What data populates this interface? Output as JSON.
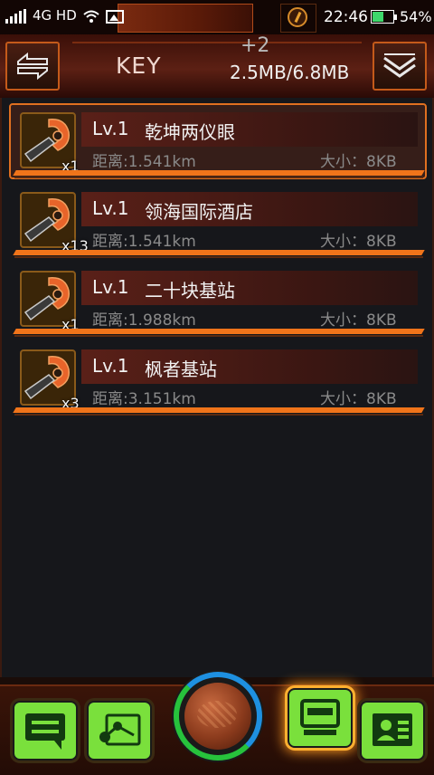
{
  "status_bar": {
    "network": "4G HD",
    "time": "22:46",
    "battery_percent": "54%",
    "battery_level": 0.54,
    "icons": [
      "signal-icon",
      "wifi-icon",
      "image-icon",
      "key-emblem-icon",
      "battery-icon"
    ]
  },
  "header": {
    "back_icon": "swap-arrows-icon",
    "title": "KEY",
    "plus_count": "+2",
    "storage": "2.5MB/6.8MB",
    "menu_icon": "chevron-stack-icon"
  },
  "keys": [
    {
      "count": "x1",
      "level": "Lv.1",
      "name": "乾坤两仪眼",
      "distance": "距离:1.541km",
      "size": "大小：8KB",
      "active": true
    },
    {
      "count": "x13",
      "level": "Lv.1",
      "name": "领海国际酒店",
      "distance": "距离:1.541km",
      "size": "大小：8KB",
      "active": false
    },
    {
      "count": "x1",
      "level": "Lv.1",
      "name": "二十块基站",
      "distance": "距离:1.988km",
      "size": "大小：8KB",
      "active": false
    },
    {
      "count": "x3",
      "level": "Lv.1",
      "name": "枫者基站",
      "distance": "距离:3.151km",
      "size": "大小：8KB",
      "active": false
    }
  ],
  "bottom_nav": {
    "buttons": [
      "chat-icon",
      "network-icon",
      "globe-icon",
      "inventory-icon",
      "profile-card-icon"
    ],
    "active": "inventory-icon",
    "colors": {
      "button": "#7ae03c",
      "accent": "#f0741a",
      "ring_blue": "#1e90e0",
      "ring_green": "#27c23c"
    }
  }
}
